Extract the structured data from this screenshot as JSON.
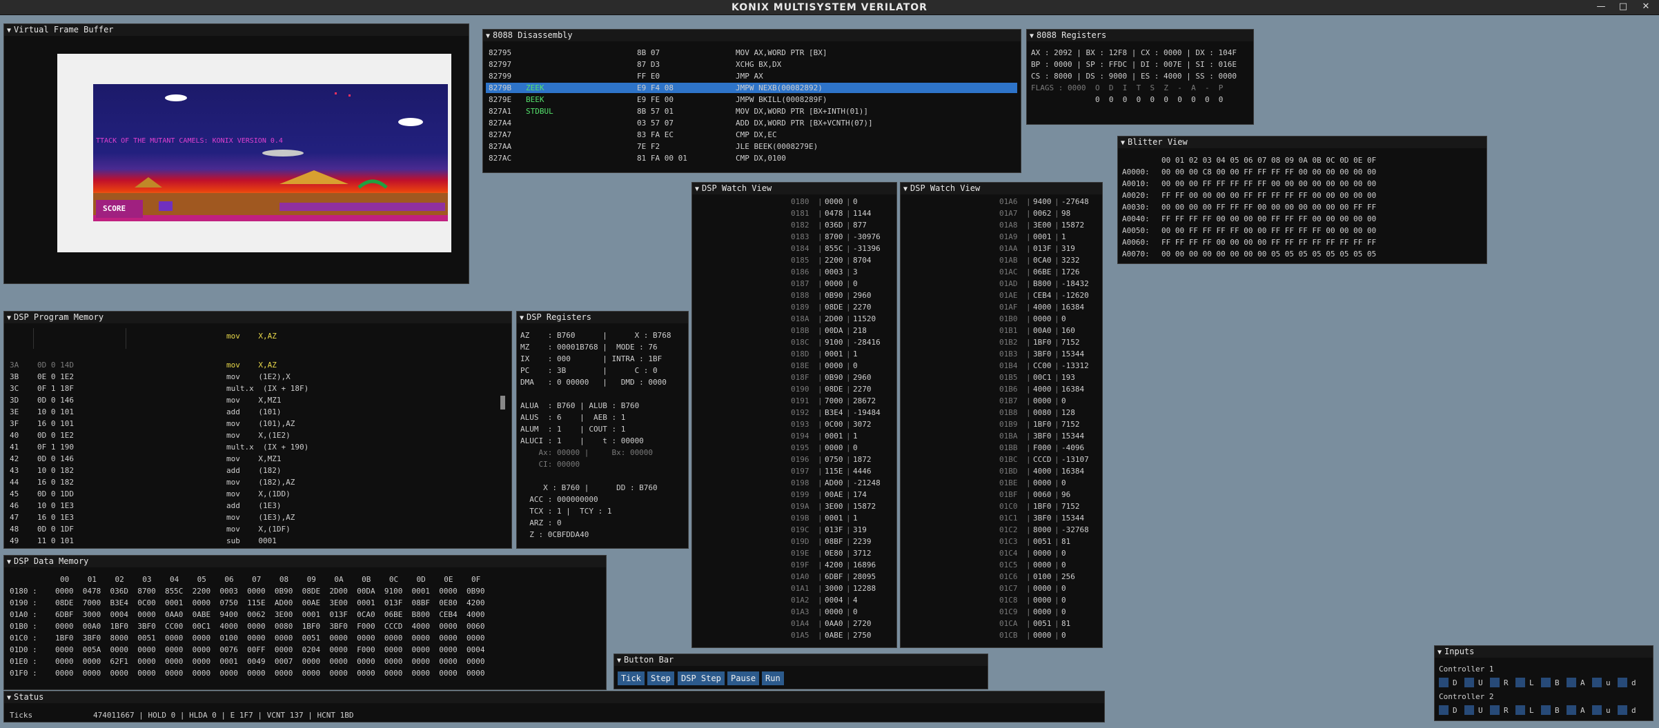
{
  "app": {
    "title": "KONIX MULTISYSTEM VERILATOR",
    "minimize": "—",
    "maximize": "□",
    "close": "✕"
  },
  "windows": {
    "vfb": "Virtual Frame Buffer",
    "disasm": "8088 Disassembly",
    "regs": "8088 Registers",
    "blitter": "Blitter View",
    "dspwatch1": "DSP Watch View",
    "dspwatch2": "DSP Watch View",
    "dspprog": "DSP Program Memory",
    "dspregs": "DSP Registers",
    "dspdata": "DSP Data Memory",
    "buttons": "Button Bar",
    "inputs": "Inputs",
    "status": "Status"
  },
  "game": {
    "banner": "TTACK OF THE MUTANT CAMELS: KONIX VERSION 0.4",
    "score": "SCORE"
  },
  "disasm": [
    [
      "82795",
      "",
      "8B 07",
      "MOV AX,WORD PTR [BX]"
    ],
    [
      "82797",
      "",
      "87 D3",
      "XCHG BX,DX"
    ],
    [
      "82799",
      "",
      "FF E0",
      "JMP AX"
    ],
    [
      "8279B",
      "ZEEK",
      "E9 F4 08",
      "JMPW NEXB(00082892)"
    ],
    [
      "8279E",
      "BEEK",
      "E9 FE 00",
      "JMPW BKILL(0008289F)"
    ],
    [
      "827A1",
      "STDBUL",
      "8B 57 01",
      "MOV DX,WORD PTR [BX+INTH(01)]"
    ],
    [
      "827A4",
      "",
      "03 57 07",
      "ADD DX,WORD PTR [BX+VCNTH(07)]"
    ],
    [
      "827A7",
      "",
      "83 FA EC",
      "CMP DX,EC"
    ],
    [
      "827AA",
      "",
      "7E F2",
      "JLE BEEK(0008279E)"
    ],
    [
      "827AC",
      "",
      "81 FA 00 01",
      "CMP DX,0100"
    ]
  ],
  "regs": {
    "lines": [
      "AX : 2092 | BX : 12F8 | CX : 0000 | DX : 104F",
      "BP : 0000 | SP : FFDC | DI : 007E | SI : 016E",
      "CS : 8000 | DS : 9000 | ES : 4000 | SS : 0000"
    ],
    "flags_label": "FLAGS : 0000",
    "flag_names": "O  D  I  T  S  Z  -  A  -  P",
    "flag_values": "0  0  0  0  0  0  0  0  0  0"
  },
  "blitter": {
    "header": "00 01 02 03 04 05 06 07 08 09 0A 0B 0C 0D 0E 0F",
    "rows": [
      [
        "A0000:",
        "00 00 00 C8 00 00 FF FF FF FF 00 00 00 00 00 00"
      ],
      [
        "A0010:",
        "00 00 00 FF FF FF FF FF 00 00 00 00 00 00 00 00"
      ],
      [
        "A0020:",
        "FF FF 00 00 00 00 FF FF FF FF FF 00 00 00 00 00"
      ],
      [
        "A0030:",
        "00 00 00 00 FF FF FF 00 00 00 00 00 00 00 FF FF"
      ],
      [
        "A0040:",
        "FF FF FF FF 00 00 00 00 FF FF FF 00 00 00 00 00"
      ],
      [
        "A0050:",
        "00 00 FF FF FF FF 00 00 FF FF FF FF 00 00 00 00"
      ],
      [
        "A0060:",
        "FF FF FF FF 00 00 00 00 FF FF FF FF FF FF FF FF"
      ],
      [
        "A0070:",
        "00 00 00 00 00 00 00 00 05 05 05 05 05 05 05 05"
      ]
    ]
  },
  "watch1": [
    [
      "0180",
      "0000",
      "0"
    ],
    [
      "0181",
      "0478",
      "1144"
    ],
    [
      "0182",
      "036D",
      "877"
    ],
    [
      "0183",
      "8700",
      "-30976"
    ],
    [
      "0184",
      "855C",
      "-31396"
    ],
    [
      "0185",
      "2200",
      "8704"
    ],
    [
      "0186",
      "0003",
      "3"
    ],
    [
      "0187",
      "0000",
      "0"
    ],
    [
      "0188",
      "0B90",
      "2960"
    ],
    [
      "0189",
      "08DE",
      "2270"
    ],
    [
      "018A",
      "2D00",
      "11520"
    ],
    [
      "018B",
      "00DA",
      "218"
    ],
    [
      "018C",
      "9100",
      "-28416"
    ],
    [
      "018D",
      "0001",
      "1"
    ],
    [
      "018E",
      "0000",
      "0"
    ],
    [
      "018F",
      "0B90",
      "2960"
    ],
    [
      "0190",
      "08DE",
      "2270"
    ],
    [
      "0191",
      "7000",
      "28672"
    ],
    [
      "0192",
      "B3E4",
      "-19484"
    ],
    [
      "0193",
      "0C00",
      "3072"
    ],
    [
      "0194",
      "0001",
      "1"
    ],
    [
      "0195",
      "0000",
      "0"
    ],
    [
      "0196",
      "0750",
      "1872"
    ],
    [
      "0197",
      "115E",
      "4446"
    ],
    [
      "0198",
      "AD00",
      "-21248"
    ],
    [
      "0199",
      "00AE",
      "174"
    ],
    [
      "019A",
      "3E00",
      "15872"
    ],
    [
      "019B",
      "0001",
      "1"
    ],
    [
      "019C",
      "013F",
      "319"
    ],
    [
      "019D",
      "08BF",
      "2239"
    ],
    [
      "019E",
      "0E80",
      "3712"
    ],
    [
      "019F",
      "4200",
      "16896"
    ],
    [
      "01A0",
      "6DBF",
      "28095"
    ],
    [
      "01A1",
      "3000",
      "12288"
    ],
    [
      "01A2",
      "0004",
      "4"
    ],
    [
      "01A3",
      "0000",
      "0"
    ],
    [
      "01A4",
      "0AA0",
      "2720"
    ],
    [
      "01A5",
      "0ABE",
      "2750"
    ]
  ],
  "watch2": [
    [
      "01A6",
      "9400",
      "-27648"
    ],
    [
      "01A7",
      "0062",
      "98"
    ],
    [
      "01A8",
      "3E00",
      "15872"
    ],
    [
      "01A9",
      "0001",
      "1"
    ],
    [
      "01AA",
      "013F",
      "319"
    ],
    [
      "01AB",
      "0CA0",
      "3232"
    ],
    [
      "01AC",
      "06BE",
      "1726"
    ],
    [
      "01AD",
      "B800",
      "-18432"
    ],
    [
      "01AE",
      "CEB4",
      "-12620"
    ],
    [
      "01AF",
      "4000",
      "16384"
    ],
    [
      "01B0",
      "0000",
      "0"
    ],
    [
      "01B1",
      "00A0",
      "160"
    ],
    [
      "01B2",
      "1BF0",
      "7152"
    ],
    [
      "01B3",
      "3BF0",
      "15344"
    ],
    [
      "01B4",
      "CC00",
      "-13312"
    ],
    [
      "01B5",
      "00C1",
      "193"
    ],
    [
      "01B6",
      "4000",
      "16384"
    ],
    [
      "01B7",
      "0000",
      "0"
    ],
    [
      "01B8",
      "0080",
      "128"
    ],
    [
      "01B9",
      "1BF0",
      "7152"
    ],
    [
      "01BA",
      "3BF0",
      "15344"
    ],
    [
      "01BB",
      "F000",
      "-4096"
    ],
    [
      "01BC",
      "CCCD",
      "-13107"
    ],
    [
      "01BD",
      "4000",
      "16384"
    ],
    [
      "01BE",
      "0000",
      "0"
    ],
    [
      "01BF",
      "0060",
      "96"
    ],
    [
      "01C0",
      "1BF0",
      "7152"
    ],
    [
      "01C1",
      "3BF0",
      "15344"
    ],
    [
      "01C2",
      "8000",
      "-32768"
    ],
    [
      "01C3",
      "0051",
      "81"
    ],
    [
      "01C4",
      "0000",
      "0"
    ],
    [
      "01C5",
      "0000",
      "0"
    ],
    [
      "01C6",
      "0100",
      "256"
    ],
    [
      "01C7",
      "0000",
      "0"
    ],
    [
      "01C8",
      "0000",
      "0"
    ],
    [
      "01C9",
      "0000",
      "0"
    ],
    [
      "01CA",
      "0051",
      "81"
    ],
    [
      "01CB",
      "0000",
      "0"
    ]
  ],
  "dspprog": {
    "first": "mov    X,AZ",
    "rows": [
      [
        "3A",
        "0D 0 14D",
        "mov    X,AZ"
      ],
      [
        "3B",
        "0E 0 1E2",
        "mov    (1E2),X"
      ],
      [
        "3C",
        "0F 1 18F",
        "mult.x  (IX + 18F)"
      ],
      [
        "3D",
        "0D 0 146",
        "mov    X,MZ1"
      ],
      [
        "3E",
        "10 0 101",
        "add    (101)"
      ],
      [
        "3F",
        "16 0 101",
        "mov    (101),AZ"
      ],
      [
        "40",
        "0D 0 1E2",
        "mov    X,(1E2)"
      ],
      [
        "41",
        "0F 1 190",
        "mult.x  (IX + 190)"
      ],
      [
        "42",
        "0D 0 146",
        "mov    X,MZ1"
      ],
      [
        "43",
        "10 0 182",
        "add    (182)"
      ],
      [
        "44",
        "16 0 182",
        "mov    (182),AZ"
      ],
      [
        "45",
        "0D 0 1DD",
        "mov    X,(1DD)"
      ],
      [
        "46",
        "10 0 1E3",
        "add    (1E3)"
      ],
      [
        "47",
        "16 0 1E3",
        "mov    (1E3),AZ"
      ],
      [
        "48",
        "0D 0 1DF",
        "mov    X,(1DF)"
      ],
      [
        "49",
        "11 0 101",
        "sub    0001"
      ]
    ]
  },
  "dspregs": [
    "AZ    : B760      |      X : B768",
    "MZ    : 00001B768 |  MODE : 76",
    "IX    : 000       | INTRA : 1BF",
    "PC    : 3B        |      C : 0",
    "DMA   : 0 00000   |   DMD : 0000",
    "",
    "ALUA  : B760 | ALUB : B760",
    "ALUS  : 6    |  AEB : 1",
    "ALUM  : 1    | COUT : 1",
    "ALUCI : 1    |    t : 00000",
    "    Ax: 00000 |     Bx: 00000",
    "    CI: 00000",
    "",
    "     X : B760 |      DD : B760",
    "  ACC : 000000000",
    "  TCX : 1 |  TCY : 1",
    "  ARZ : 0",
    "  Z : 0CBFDDA40"
  ],
  "dspdata": {
    "header": "00    01    02    03    04    05    06    07    08    09    0A    0B    0C    0D    0E    0F",
    "rows": [
      [
        "0180 :",
        "0000  0478  036D  8700  855C  2200  0003  0000  0B90  08DE  2D00  00DA  9100  0001  0000  0B90"
      ],
      [
        "0190 :",
        "08DE  7000  B3E4  0C00  0001  0000  0750  115E  AD00  00AE  3E00  0001  013F  08BF  0E80  4200"
      ],
      [
        "01A0 :",
        "6DBF  3000  0004  0000  0AA0  0ABE  9400  0062  3E00  0001  013F  0CA0  06BE  B800  CEB4  4000"
      ],
      [
        "01B0 :",
        "0000  00A0  1BF0  3BF0  CC00  00C1  4000  0000  0080  1BF0  3BF0  F000  CCCD  4000  0000  0060"
      ],
      [
        "01C0 :",
        "1BF0  3BF0  8000  0051  0000  0000  0100  0000  0000  0051  0000  0000  0000  0000  0000  0000"
      ],
      [
        "01D0 :",
        "0000  005A  0000  0000  0000  0000  0076  00FF  0000  0204  0000  F000  0000  0000  0000  0004"
      ],
      [
        "01E0 :",
        "0000  0000  62F1  0000  0000  0000  0001  0049  0007  0000  0000  0000  0000  0000  0000  0000"
      ],
      [
        "01F0 :",
        "0000  0000  0000  0000  0000  0000  0000  0000  0000  0000  0000  0000  0000  0000  0000  0000"
      ]
    ]
  },
  "buttons": [
    "Tick",
    "Step",
    "DSP Step",
    "Pause",
    "Run"
  ],
  "inputs": {
    "c1": "Controller 1",
    "c2": "Controller 2",
    "keys": [
      "D",
      "U",
      "R",
      "L",
      "B",
      "A",
      "u",
      "d"
    ]
  },
  "status": {
    "label": "Ticks",
    "value": "474011667 | HOLD 0 | HLDA 0 | E 1F7 | VCNT 137 | HCNT 1BD"
  }
}
